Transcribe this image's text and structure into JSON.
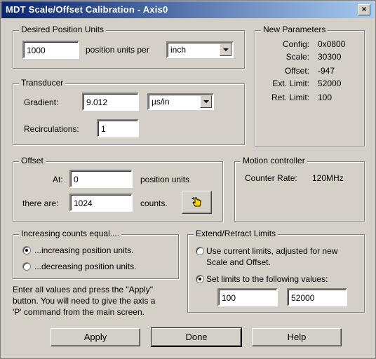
{
  "window": {
    "title": "MDT Scale/Offset Calibration - Axis0",
    "close_glyph": "×"
  },
  "desired_units": {
    "legend": "Desired Position Units",
    "value": "1000",
    "per_label": "position units per",
    "unit_selected": "inch"
  },
  "transducer": {
    "legend": "Transducer",
    "gradient_label": "Gradient:",
    "gradient_value": "9.012",
    "gradient_unit": "µs/in",
    "recirc_label": "Recirculations:",
    "recirc_value": "1"
  },
  "offset": {
    "legend": "Offset",
    "at_label": "At:",
    "at_value": "0",
    "at_unit": "position units",
    "there_label": "there are:",
    "there_value": "1024",
    "there_unit": "counts."
  },
  "increasing": {
    "legend": "Increasing counts equal....",
    "opt1": "...increasing position units.",
    "opt2": "...decreasing position units.",
    "selected": 1
  },
  "instructions": {
    "line1": "Enter all values and press the \"Apply\"",
    "line2": "button.  You will need to give the axis a",
    "line3": "'P' command from the main screen."
  },
  "new_params": {
    "legend": "New Parameters",
    "rows": [
      {
        "label": "Config:",
        "value": "0x0800"
      },
      {
        "label": "Scale:",
        "value": "30300"
      },
      {
        "label": "Offset:",
        "value": "-947"
      },
      {
        "label": "Ext. Limit:",
        "value": "52000"
      },
      {
        "label": "Ret. Limit:",
        "value": "100"
      }
    ]
  },
  "motion": {
    "legend": "Motion controller",
    "counter_label": "Counter Rate:",
    "counter_value": "120MHz"
  },
  "limits": {
    "legend": "Extend/Retract Limits",
    "opt1_line1": "Use current limits, adjusted for new",
    "opt1_line2": "Scale and Offset.",
    "opt2": "Set limits to the following values:",
    "selected": 2,
    "retract_value": "100",
    "extend_value": "52000"
  },
  "buttons": {
    "apply": "Apply",
    "done": "Done",
    "help": "Help"
  },
  "icons": {
    "capture": "hand-pointer-icon"
  }
}
